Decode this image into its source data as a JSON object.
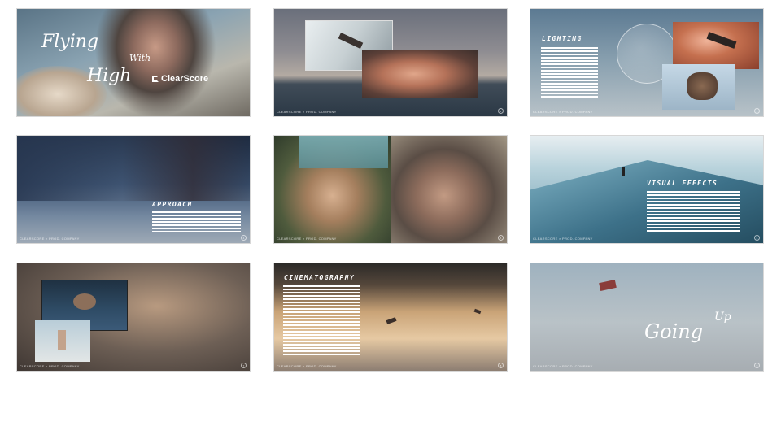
{
  "slides": [
    {
      "id": "flying-high",
      "script_words": [
        "Flying",
        "With",
        "High"
      ],
      "logo_text": "ClearScore"
    },
    {
      "id": "falling",
      "footer": "ClearScore × Prod. Company"
    },
    {
      "id": "lighting",
      "heading": "LIGHTING",
      "footer": "ClearScore × Prod. Company"
    },
    {
      "id": "approach",
      "heading": "APPROACH",
      "footer": "ClearScore × Prod. Company"
    },
    {
      "id": "girl-and-bubbles",
      "footer": "ClearScore × Prod. Company"
    },
    {
      "id": "visual-effects",
      "heading": "VISUAL EFFECTS",
      "footer": "ClearScore × Prod. Company"
    },
    {
      "id": "clouds",
      "footer": "ClearScore × Prod. Company"
    },
    {
      "id": "cinematography",
      "heading": "CINEMATOGRAPHY",
      "footer": "ClearScore × Prod. Company"
    },
    {
      "id": "going-up",
      "script_words": [
        "Up",
        "Going"
      ],
      "footer": "ClearScore × Prod. Company"
    }
  ]
}
